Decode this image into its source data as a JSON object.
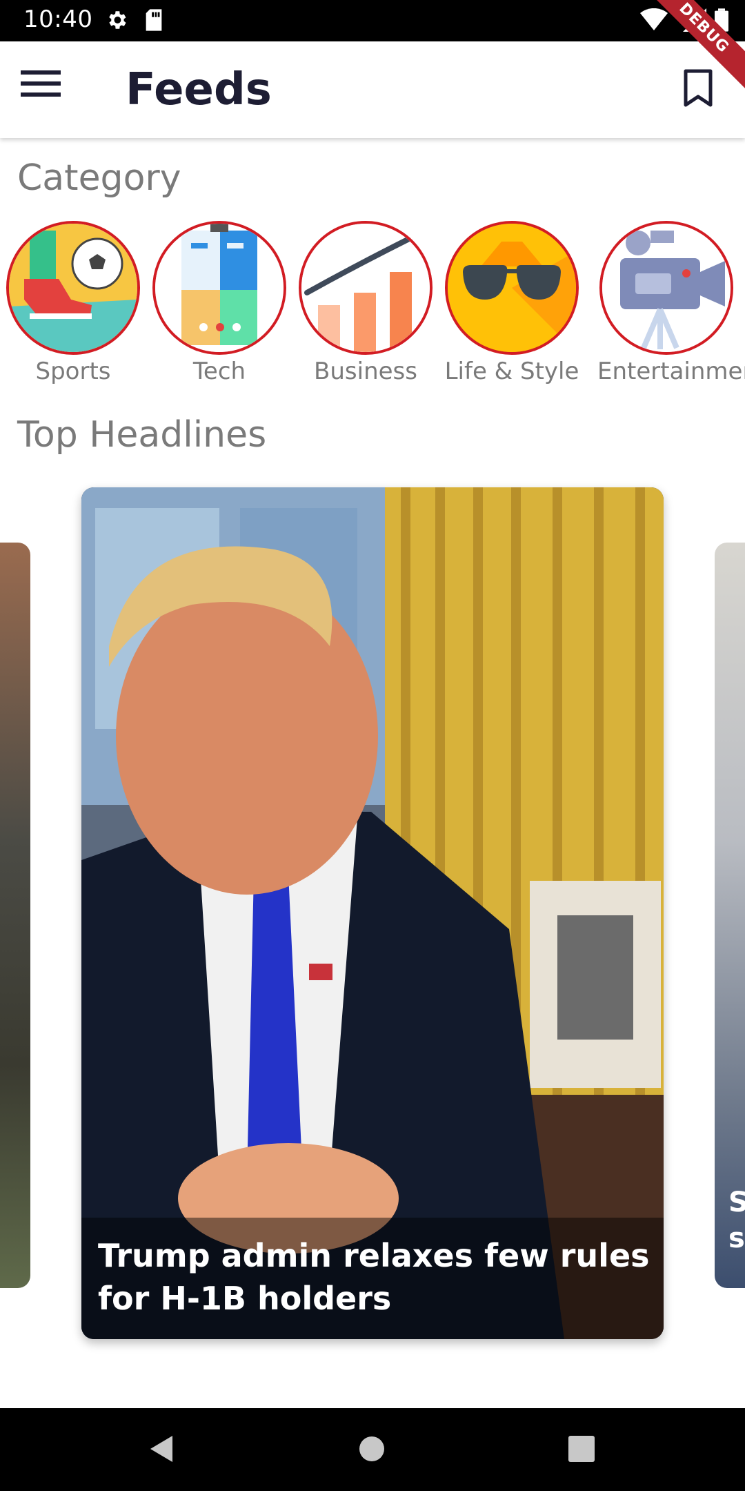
{
  "status_bar": {
    "time": "10:40",
    "icons": [
      "settings-icon",
      "sd-card-icon",
      "wifi-icon",
      "battery-icon"
    ]
  },
  "app_bar": {
    "title": "Feeds",
    "menu_icon": "menu-icon",
    "bookmark_icon": "bookmark-icon",
    "debug_banner": "DEBUG"
  },
  "categories": {
    "title": "Category",
    "items": [
      {
        "label": "Sports",
        "icon": "sports-icon"
      },
      {
        "label": "Tech",
        "icon": "tech-icon"
      },
      {
        "label": "Business",
        "icon": "business-icon"
      },
      {
        "label": "Life & Style",
        "icon": "sunglasses-icon"
      },
      {
        "label": "Entertainment",
        "icon": "video-camera-icon"
      }
    ]
  },
  "headlines": {
    "title": "Top Headlines",
    "main_card": {
      "caption": "Trump admin relaxes few rules for H-1B holders"
    },
    "right_card_peek": "S\ns"
  },
  "nav_bar": {
    "buttons": [
      "back-icon",
      "home-icon",
      "recents-icon"
    ]
  },
  "colors": {
    "category_border": "#d21c23",
    "title_text": "#1d1d33",
    "section_text": "#7a7a7a"
  }
}
